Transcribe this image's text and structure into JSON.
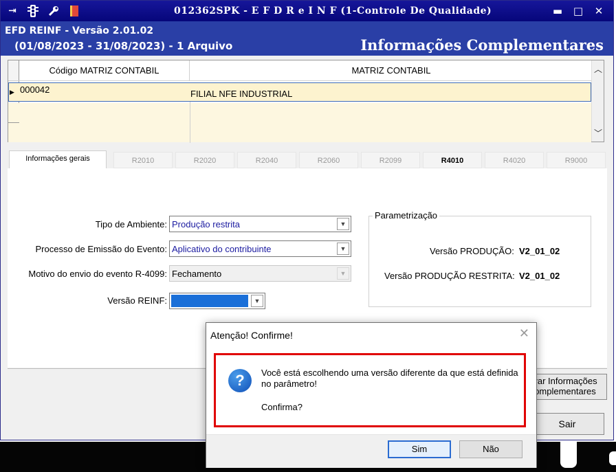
{
  "window": {
    "title": "012362SPK - E F D  R e I N F (1-Controle De Qualidade)",
    "controls": {
      "minimize": "▬",
      "maximize": "□",
      "close": "✕"
    }
  },
  "header": {
    "line1": "EFD REINF - Versão 2.01.02",
    "line2": "(01/08/2023 - 31/08/2023) - 1 Arquivo",
    "section_title": "Informações Complementares"
  },
  "grid": {
    "columns": [
      "Código MATRIZ CONTABIL",
      "MATRIZ CONTABIL"
    ],
    "rows": [
      {
        "codigo": "000042",
        "nome": "FILIAL NFE INDUSTRIAL"
      }
    ]
  },
  "tabs": [
    {
      "label": "Informações gerais",
      "active": true
    },
    {
      "label": "R2010"
    },
    {
      "label": "R2020"
    },
    {
      "label": "R2040"
    },
    {
      "label": "R2060"
    },
    {
      "label": "R2099"
    },
    {
      "label": "R4010",
      "bold": true
    },
    {
      "label": "R4020"
    },
    {
      "label": "R9000"
    }
  ],
  "form": {
    "tipo_ambiente": {
      "label": "Tipo de Ambiente:",
      "value": "Produção restrita"
    },
    "processo_emissao": {
      "label": "Processo de Emissão do Evento:",
      "value": "Aplicativo do contribuinte"
    },
    "motivo_envio": {
      "label": "Motivo do envio do evento R-4099:",
      "value": "Fechamento"
    },
    "versao_reinf": {
      "label": "Versão REINF:",
      "value": ""
    }
  },
  "parametrizacao": {
    "title": "Parametrização",
    "producao_label": "Versão PRODUÇÃO:",
    "producao_value": "V2_01_02",
    "restrita_label": "Versão PRODUÇÃO RESTRITA:",
    "restrita_value": "V2_01_02"
  },
  "buttons": {
    "salvar_line1": "var Informações",
    "salvar_line2": "omplementares",
    "sair": "Sair"
  },
  "dialog": {
    "title": "Atenção! Confirme!",
    "message": "Você está escolhendo uma versão diferente da que está definida no parâmetro!",
    "confirm": "Confirma?",
    "yes": "Sim",
    "no": "Não"
  },
  "colors": {
    "titlebar": "#06067a",
    "header": "#2a3fa6",
    "selected_row": "#fdf3cf",
    "alert_border": "#e00000"
  }
}
